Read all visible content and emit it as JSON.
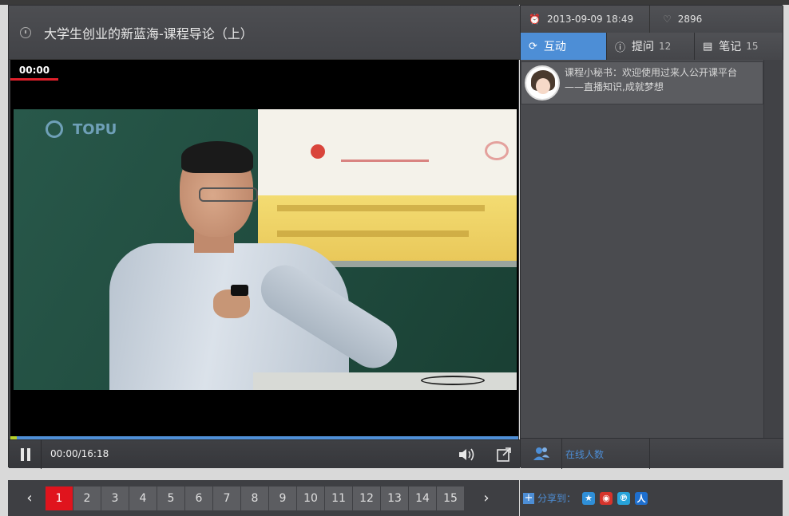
{
  "player": {
    "title": "大学生创业的新蓝海-课程导论（上）",
    "time_badge": "00:00",
    "timecode": "00:00/16:18",
    "played_fraction": 0.0,
    "brand": "TOPU"
  },
  "side": {
    "date": "2013-09-09 18:49",
    "likes": "2896",
    "tabs": [
      {
        "label": "互动",
        "count": ""
      },
      {
        "label": "提问",
        "count": "12"
      },
      {
        "label": "笔记",
        "count": "15"
      }
    ],
    "message": {
      "line1": "课程小秘书：欢迎使用过来人公开课平台",
      "line2": "——直播知识,成就梦想"
    },
    "online_label": "在线人数"
  },
  "pager": {
    "prev": "‹",
    "next": "›",
    "pages": [
      "1",
      "2",
      "3",
      "4",
      "5",
      "6",
      "7",
      "8",
      "9",
      "10",
      "11",
      "12",
      "13",
      "14",
      "15"
    ],
    "active": "1"
  },
  "share": {
    "label": "分享到：",
    "plus": "+"
  },
  "colors": {
    "accent": "#4d8ed6",
    "active_page": "#e0141d"
  }
}
